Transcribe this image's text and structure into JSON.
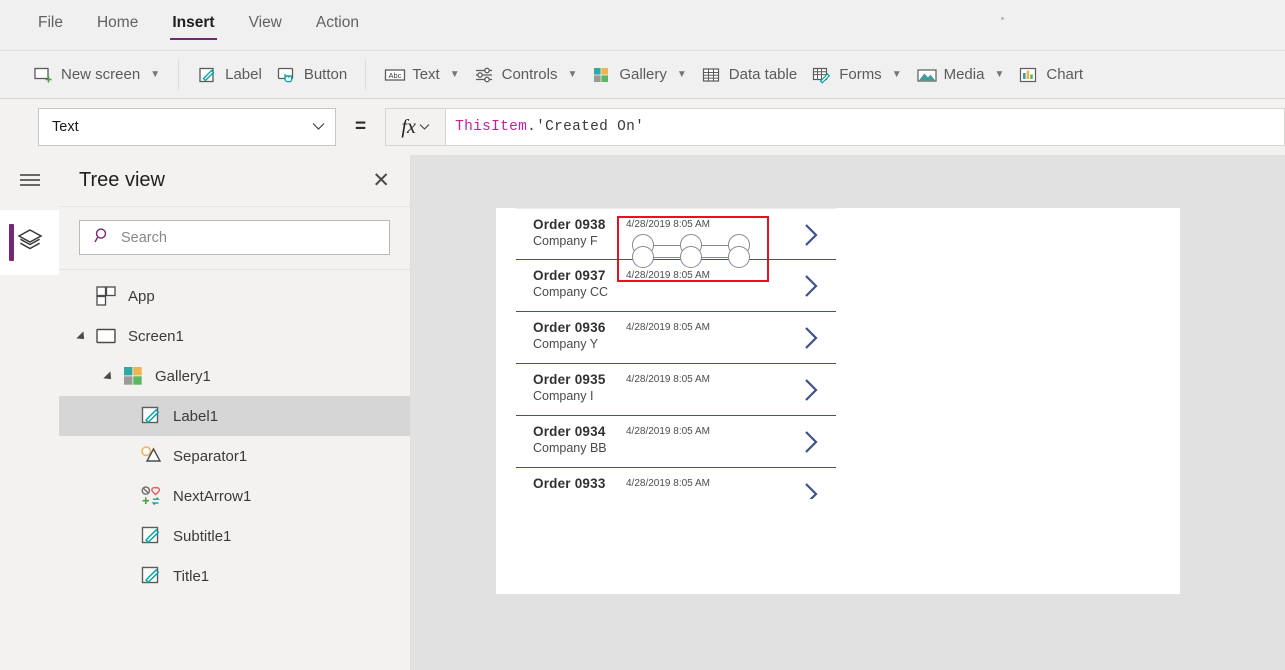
{
  "menubar": {
    "items": [
      {
        "label": "File",
        "active": false
      },
      {
        "label": "Home",
        "active": false
      },
      {
        "label": "Insert",
        "active": true
      },
      {
        "label": "View",
        "active": false
      },
      {
        "label": "Action",
        "active": false
      }
    ]
  },
  "ribbon": {
    "groups": [
      {
        "buttons": [
          {
            "label": "New screen",
            "icon": "new-screen-icon",
            "caret": true
          }
        ]
      },
      {
        "buttons": [
          {
            "label": "Label",
            "icon": "label-icon",
            "caret": false
          },
          {
            "label": "Button",
            "icon": "button-icon",
            "caret": false
          }
        ]
      },
      {
        "buttons": [
          {
            "label": "Text",
            "icon": "text-abc-icon",
            "caret": true
          },
          {
            "label": "Controls",
            "icon": "controls-sliders-icon",
            "caret": true
          },
          {
            "label": "Gallery",
            "icon": "gallery-icon",
            "caret": true
          },
          {
            "label": "Data table",
            "icon": "data-table-icon",
            "caret": false
          },
          {
            "label": "Forms",
            "icon": "forms-icon",
            "caret": true
          },
          {
            "label": "Media",
            "icon": "media-image-icon",
            "caret": true
          },
          {
            "label": "Chart",
            "icon": "charts-icon",
            "caret": false
          }
        ]
      }
    ]
  },
  "formula_bar": {
    "property_selected": "Text",
    "equals": "=",
    "fx_glyph": "fx",
    "formula_object": "ThisItem",
    "formula_rest": ".'Created On'"
  },
  "rail": {
    "hamburger": "hamburger-icon",
    "active_item": "tree-view-layers-icon"
  },
  "treeview": {
    "title": "Tree view",
    "close_label": "✕",
    "search_placeholder": "Search",
    "items": [
      {
        "label": "App",
        "icon": "app-icon",
        "indent": 36,
        "caret": false,
        "selected": false
      },
      {
        "label": "Screen1",
        "icon": "screen-icon",
        "indent": 36,
        "caret": true,
        "selected": false
      },
      {
        "label": "Gallery1",
        "icon": "gallery-icon",
        "indent": 63,
        "caret": true,
        "selected": false
      },
      {
        "label": "Label1",
        "icon": "label-icon",
        "indent": 81,
        "caret": false,
        "selected": true
      },
      {
        "label": "Separator1",
        "icon": "shapes-icon",
        "indent": 81,
        "caret": false,
        "selected": false
      },
      {
        "label": "NextArrow1",
        "icon": "icons-icon",
        "indent": 81,
        "caret": false,
        "selected": false
      },
      {
        "label": "Subtitle1",
        "icon": "label-icon",
        "indent": 81,
        "caret": false,
        "selected": false
      },
      {
        "label": "Title1",
        "icon": "label-icon",
        "indent": 81,
        "caret": false,
        "selected": false
      }
    ]
  },
  "canvas": {
    "gallery_rows": [
      {
        "title": "Order 0938",
        "subtitle": "Company F",
        "date": "4/28/2019 8:05 AM",
        "selected": true,
        "clipped": false
      },
      {
        "title": "Order 0937",
        "subtitle": "Company CC",
        "date": "4/28/2019 8:05 AM",
        "selected": false,
        "clipped": false
      },
      {
        "title": "Order 0936",
        "subtitle": "Company Y",
        "date": "4/28/2019 8:05 AM",
        "selected": false,
        "clipped": false
      },
      {
        "title": "Order 0935",
        "subtitle": "Company I",
        "date": "4/28/2019 8:05 AM",
        "selected": false,
        "clipped": false
      },
      {
        "title": "Order 0934",
        "subtitle": "Company BB",
        "date": "4/28/2019 8:05 AM",
        "selected": false,
        "clipped": false
      },
      {
        "title": "Order 0933",
        "subtitle": "",
        "date": "4/28/2019 8:05 AM",
        "selected": false,
        "clipped": true
      }
    ]
  },
  "colors": {
    "accent_purple": "#742774",
    "selection_red": "#e81123",
    "chevron_navy": "#41508f",
    "formula_token": "#c3219b"
  }
}
